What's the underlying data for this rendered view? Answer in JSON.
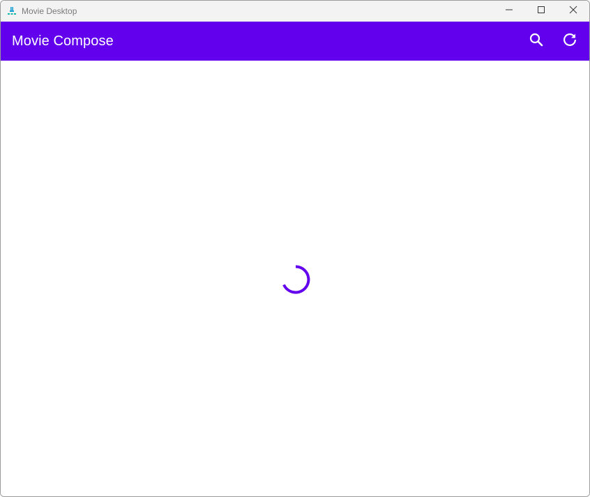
{
  "window": {
    "title": "Movie Desktop",
    "icon": "compose-app-icon",
    "controls": [
      "minimize-icon",
      "maximize-icon",
      "close-icon"
    ]
  },
  "appbar": {
    "title": "Movie Compose",
    "actions": [
      "search-icon",
      "refresh-icon"
    ]
  },
  "content": {
    "state": "loading",
    "indicator": "circular-progress-indicator"
  },
  "colors": {
    "primary": "#6200ee",
    "on_primary": "#ffffff",
    "titlebar": "#f3f3f3"
  }
}
